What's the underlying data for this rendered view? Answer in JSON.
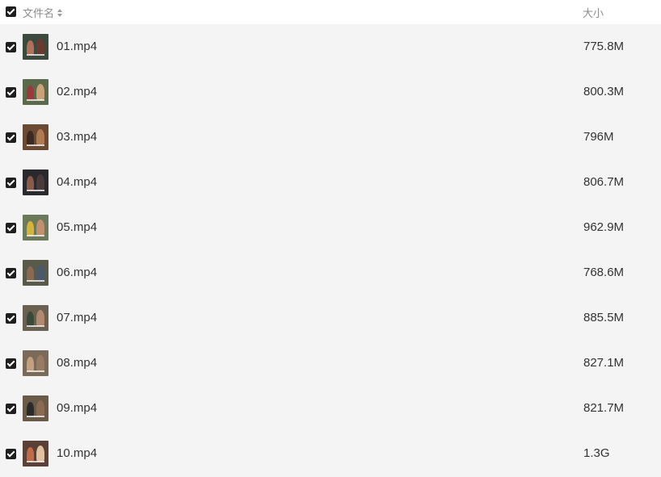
{
  "header": {
    "name_label": "文件名",
    "size_label": "大小"
  },
  "files": [
    {
      "name": "01.mp4",
      "size": "775.8M",
      "thumb_bg": "#3c4a3e",
      "thumb_a": "#b0705a",
      "thumb_b": "#6a3a30"
    },
    {
      "name": "02.mp4",
      "size": "800.3M",
      "thumb_bg": "#5a6a4a",
      "thumb_a": "#9a3a3a",
      "thumb_b": "#c9a27a"
    },
    {
      "name": "03.mp4",
      "size": "796M",
      "thumb_bg": "#6b4a34",
      "thumb_a": "#3a2a22",
      "thumb_b": "#b07a52"
    },
    {
      "name": "04.mp4",
      "size": "806.7M",
      "thumb_bg": "#2a2a2e",
      "thumb_a": "#8a5a4a",
      "thumb_b": "#4a3a3a"
    },
    {
      "name": "05.mp4",
      "size": "962.9M",
      "thumb_bg": "#6a7a5a",
      "thumb_a": "#d4b43a",
      "thumb_b": "#c09070"
    },
    {
      "name": "06.mp4",
      "size": "768.6M",
      "thumb_bg": "#5a5a4a",
      "thumb_a": "#8a6a52",
      "thumb_b": "#4a5a6a"
    },
    {
      "name": "07.mp4",
      "size": "885.5M",
      "thumb_bg": "#6a6050",
      "thumb_a": "#3a4a3a",
      "thumb_b": "#b08a70"
    },
    {
      "name": "08.mp4",
      "size": "827.1M",
      "thumb_bg": "#7a6a5a",
      "thumb_a": "#c4a080",
      "thumb_b": "#9a7a62"
    },
    {
      "name": "09.mp4",
      "size": "821.7M",
      "thumb_bg": "#6a5a48",
      "thumb_a": "#2a2a2a",
      "thumb_b": "#8a6a50"
    },
    {
      "name": "10.mp4",
      "size": "1.3G",
      "thumb_bg": "#5a4036",
      "thumb_a": "#c06a4a",
      "thumb_b": "#e0c0a0"
    }
  ]
}
